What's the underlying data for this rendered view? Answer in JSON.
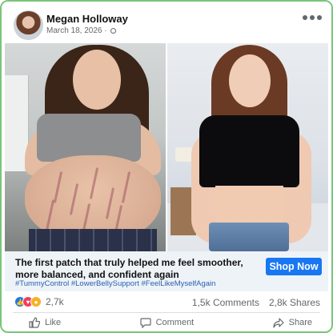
{
  "post": {
    "author": "Megan Holloway",
    "date": "March 18, 2026",
    "date_suffix": " · ",
    "caption_title": "The first patch that truly helped me feel smoother, more balanced, and confident again",
    "hashtags": "#TummyControl #LowerBellySupport #FeelLikeMyselfAgain",
    "cta_label": "Shop Now",
    "reaction_count": "2,7k",
    "comments": "1,5k Comments",
    "shares": "2,8k Shares",
    "reactions": [
      "like-icon",
      "love-icon",
      "wow-icon"
    ]
  },
  "actions": {
    "like": "Like",
    "comment": "Comment",
    "share": "Share"
  },
  "colors": {
    "frame": "#7ac57a",
    "accent": "#1877f2",
    "caption_bg": "#eef3f8",
    "hashtag": "#2a5fb0"
  }
}
